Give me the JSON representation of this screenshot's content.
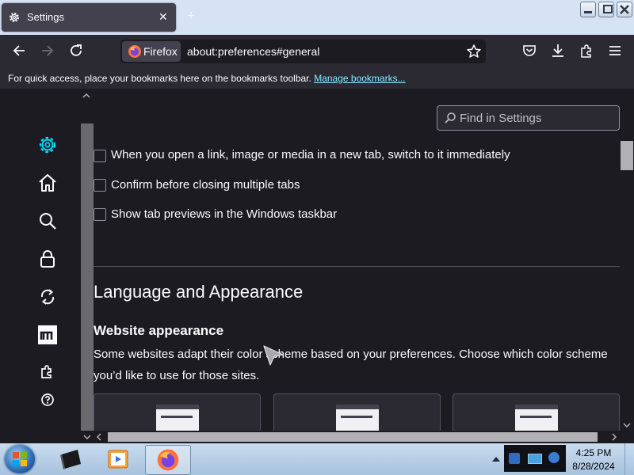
{
  "tab": {
    "title": "Settings",
    "close_glyph": "✕",
    "new_tab_glyph": "+"
  },
  "navbar": {
    "identity_label": "Firefox",
    "url": "about:preferences#general"
  },
  "bookmarks_bar": {
    "message": "For quick access, place your bookmarks here on the bookmarks toolbar.",
    "link": "Manage bookmarks..."
  },
  "sidebar": {
    "items": [
      {
        "icon": "gear-icon",
        "active": true
      },
      {
        "icon": "home-icon"
      },
      {
        "icon": "search-icon"
      },
      {
        "icon": "lock-icon"
      },
      {
        "icon": "sync-icon"
      },
      {
        "icon": "mozilla-icon"
      },
      {
        "icon": "extensions-icon"
      },
      {
        "icon": "help-icon"
      }
    ]
  },
  "search": {
    "placeholder": "Find in Settings"
  },
  "options": [
    {
      "label": "When you open a link, image or media in a new tab, switch to it immediately",
      "checked": false
    },
    {
      "label": "Confirm before closing multiple tabs",
      "checked": false
    },
    {
      "label": "Show tab previews in the Windows taskbar",
      "checked": false
    }
  ],
  "section": {
    "title": "Language and Appearance",
    "subheading": "Website appearance",
    "description": "Some websites adapt their color scheme based on your preferences. Choose which color scheme you’d like to use for those sites."
  },
  "taskbar": {
    "time": "4:25 PM",
    "date": "8/28/2024"
  },
  "colors": {
    "accent": "#00ddff",
    "link": "#80ebff",
    "background": "#1c1b22",
    "toolbar": "#2b2a33"
  }
}
